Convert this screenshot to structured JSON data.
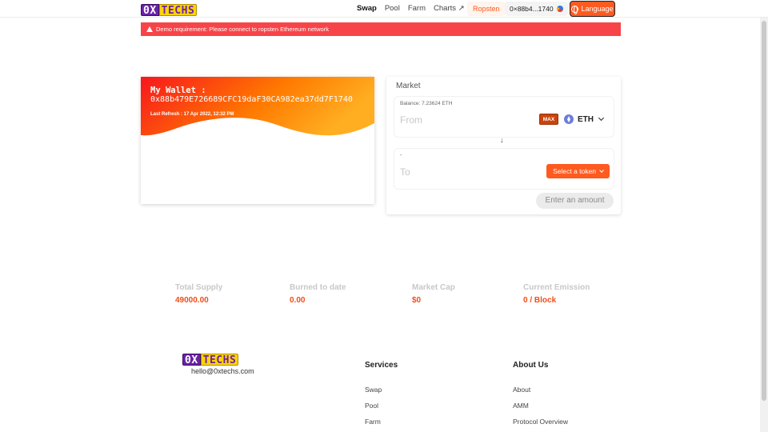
{
  "brand": {
    "logo_left": "0X",
    "logo_right": "TECHS"
  },
  "nav": {
    "items": [
      {
        "label": "Swap"
      },
      {
        "label": "Pool"
      },
      {
        "label": "Farm"
      },
      {
        "label": "Charts ↗"
      }
    ],
    "network": "Ropsten",
    "account": "0×88b4...1740",
    "language_label": "Language"
  },
  "alert": {
    "text": "Demo requirement: Please connect to ropsten Ethereum network"
  },
  "wallet": {
    "title": "My Wallet :",
    "address": "0x88b479E726689CFC19daF30CA982ea37dd7F1740",
    "last_refresh": "Last Refresh : 17 Apr 2022, 12:32 PM",
    "gradient": [
      "#f8161d",
      "#ff7a00",
      "#ffae22"
    ]
  },
  "market": {
    "title": "Market",
    "from": {
      "balance": "Balance: 7.23624 ETH",
      "placeholder": "From",
      "max_label": "MAX",
      "token": "ETH"
    },
    "arrow": "↓",
    "to": {
      "balance": "-",
      "placeholder": "To",
      "select_label": "Select a token"
    },
    "submit_label": "Enter an amount"
  },
  "stats": [
    {
      "label": "Total Supply",
      "value": "49000.00"
    },
    {
      "label": "Burned to date",
      "value": "0.00"
    },
    {
      "label": "Market Cap",
      "value": "$0"
    },
    {
      "label": "Current Emission",
      "value": "0 / Block"
    }
  ],
  "footer": {
    "email": "hello@0xtechs.com",
    "services": {
      "title": "Services",
      "links": [
        "Swap",
        "Pool",
        "Farm"
      ]
    },
    "about": {
      "title": "About Us",
      "links": [
        "About",
        "AMM",
        "Protocol Overview"
      ]
    }
  },
  "colors": {
    "accent": "#ff5a1f",
    "alert": "#f74448",
    "stat_value": "#f24d16"
  }
}
